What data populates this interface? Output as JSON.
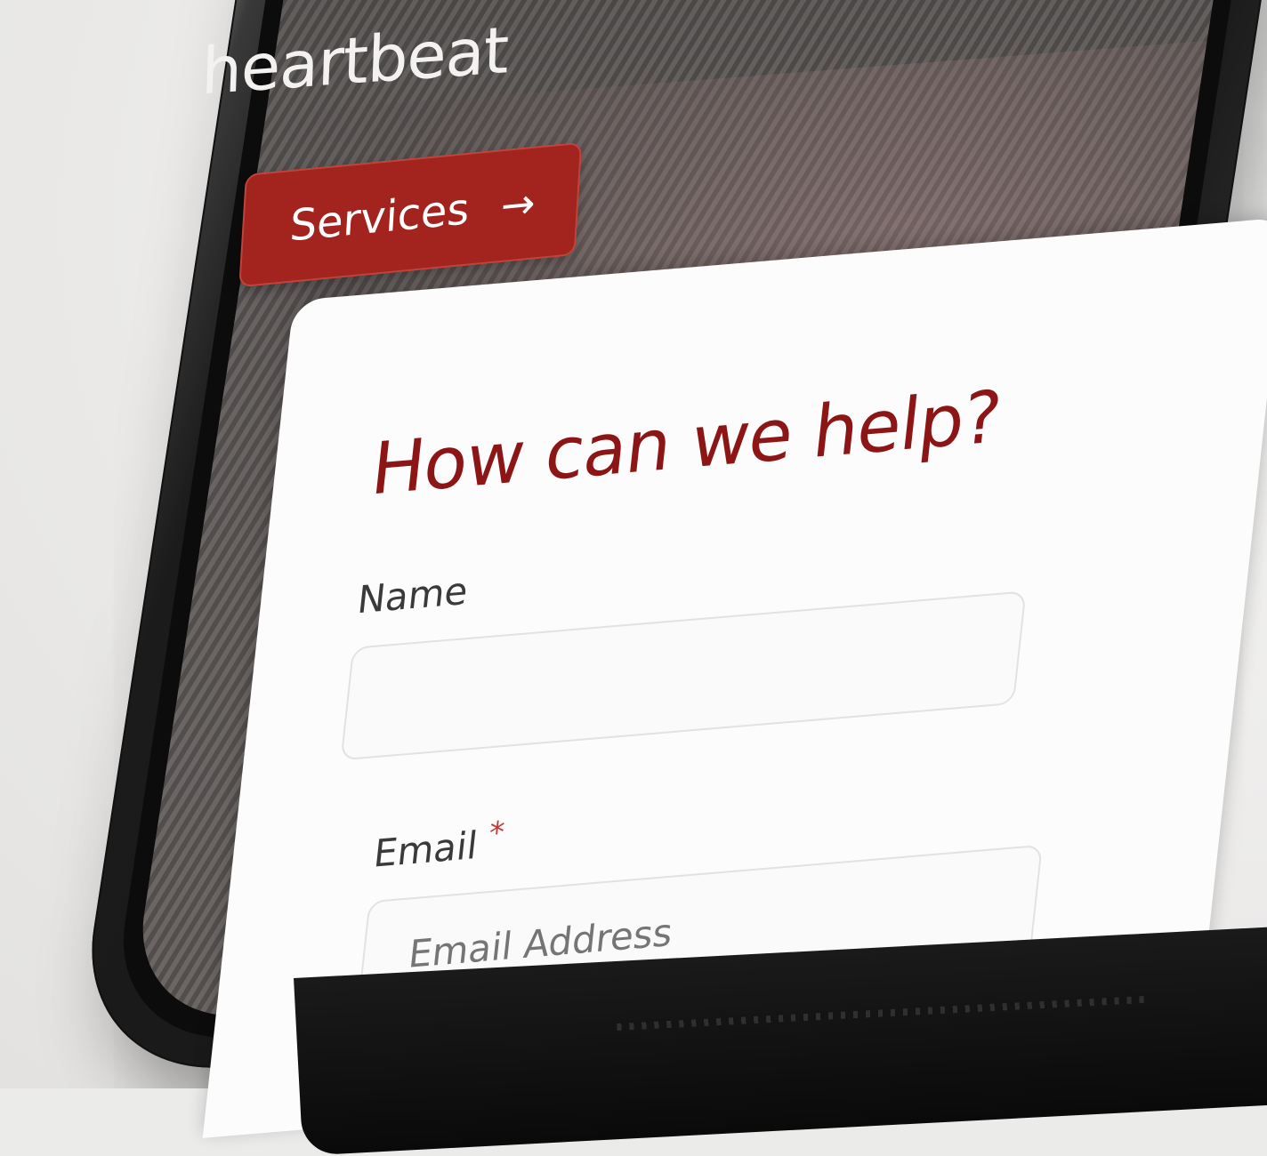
{
  "brand": {
    "text": "heartbeat"
  },
  "hero": {
    "cta_label": "Services",
    "cta_icon": "arrow-right-icon",
    "cta_glyph": "→",
    "cta_color": "#a3231f"
  },
  "form": {
    "title": "How can we help?",
    "title_color": "#8c1515",
    "fields": [
      {
        "label": "Name",
        "required": false,
        "value": "",
        "placeholder": ""
      },
      {
        "label": "Email",
        "required": true,
        "required_marker": "*",
        "value": "",
        "placeholder": "Email Address"
      }
    ]
  }
}
